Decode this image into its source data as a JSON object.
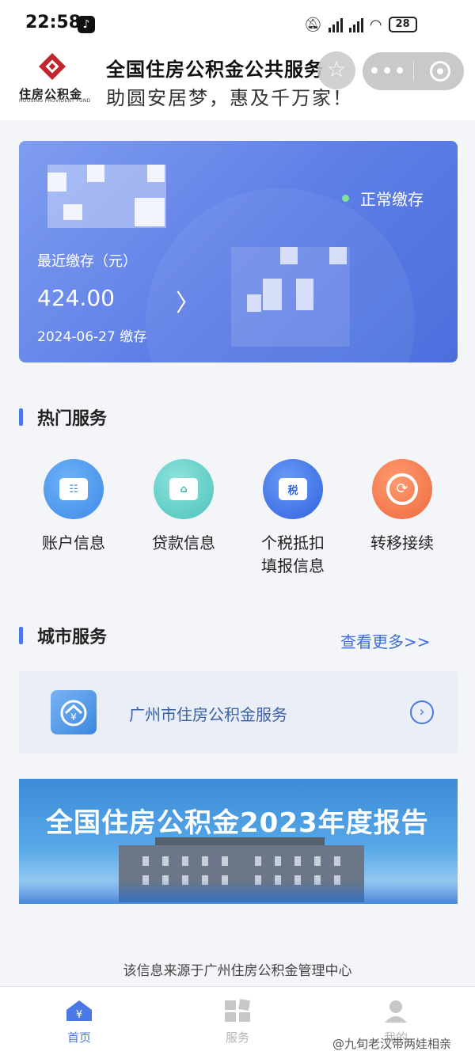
{
  "status_bar": {
    "time": "22:58",
    "battery": "28"
  },
  "header": {
    "logo_cn": "住房公积金",
    "logo_en": "HOUSING PROVIDENT FUND",
    "title": "全国住房公积金公共服务",
    "slogan": "助圆安居梦，惠及千万家！"
  },
  "account_card": {
    "status": "正常缴存",
    "recent_label": "最近缴存（元）",
    "amount": "424.00",
    "date_text": "2024-06-27 缴存"
  },
  "hot_services": {
    "title": "热门服务",
    "items": [
      {
        "label": "账户信息",
        "icon_glyph": "☷"
      },
      {
        "label": "贷款信息",
        "icon_glyph": "⌂"
      },
      {
        "label": "个税抵扣",
        "label2": "填报信息",
        "icon_glyph": "税"
      },
      {
        "label": "转移接续",
        "icon_glyph": "⟳"
      }
    ]
  },
  "city_services": {
    "title": "城市服务",
    "more": "查看更多>>",
    "item": "广州市住房公积金服务"
  },
  "banner": {
    "text": "全国住房公积金2023年度报告"
  },
  "footer_note": "该信息来源于广州住房公积金管理中心",
  "tabbar": {
    "home": "首页",
    "service": "服务",
    "mine": "我的"
  },
  "watermark": "@九旬老汉带两娃相亲",
  "colors": {
    "primary": "#4a78e6",
    "card_bg": "#5d7de6",
    "accent_orange": "#ee6a3f",
    "logo_red": "#c0272d"
  }
}
